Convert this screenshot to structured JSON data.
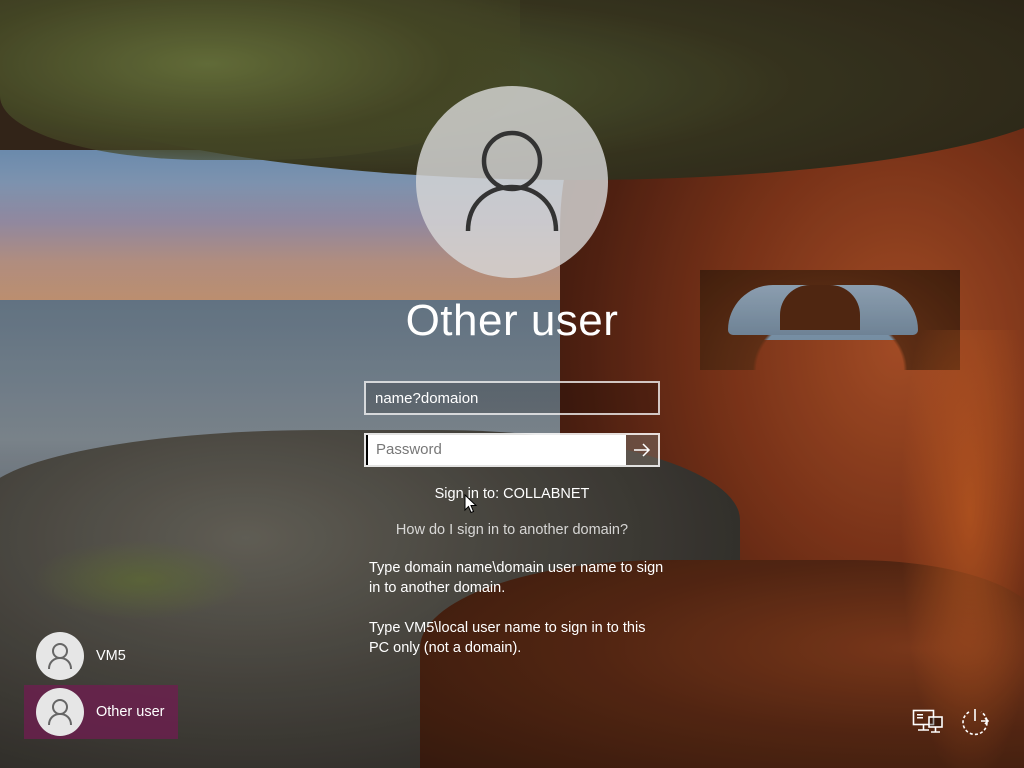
{
  "screen": {
    "title": "Other user",
    "avatar_icon": "user-icon"
  },
  "form": {
    "username_value": "name?domaion",
    "password_placeholder": "Password",
    "submit_icon": "arrow-right-icon",
    "sign_in_to": "Sign in to: COLLABNET",
    "help_link": "How do I sign in to another domain?",
    "help_text_1": "Type domain name\\domain user name to sign in to another domain.",
    "help_text_2": "Type VM5\\local user name to sign in to this PC only (not a domain)."
  },
  "users": [
    {
      "label": "VM5",
      "icon": "user-icon",
      "selected": false
    },
    {
      "label": "Other user",
      "icon": "user-icon",
      "selected": true
    }
  ],
  "system_icons": {
    "network": "network-icon",
    "power": "power-icon"
  },
  "colors": {
    "selected_user_bg": "#6e1e50",
    "text": "#ffffff"
  }
}
